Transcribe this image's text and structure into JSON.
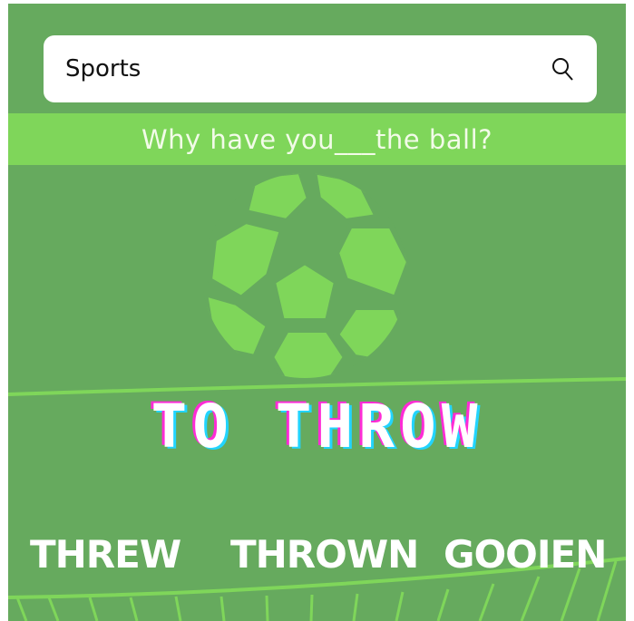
{
  "search": {
    "value": "Sports",
    "icon": "search-icon"
  },
  "question": {
    "text": "Why have you___the ball?"
  },
  "graphic": {
    "icon": "soccer-ball-icon"
  },
  "verb": {
    "infinitive": "TO THROW"
  },
  "answers": [
    {
      "label": "THREW"
    },
    {
      "label": "THROWN"
    },
    {
      "label": "GOOIEN"
    }
  ],
  "colors": {
    "background": "#66aa5e",
    "band": "#7fd65a",
    "ball": "#7fd65a",
    "title_shadow_pink": "#ff2bd6",
    "title_shadow_cyan": "#22d4ff"
  }
}
